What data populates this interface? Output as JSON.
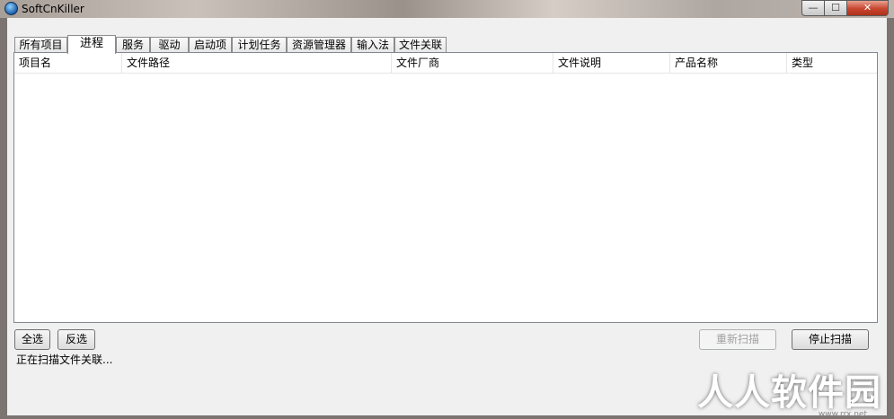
{
  "window": {
    "title": "SoftCnKiller",
    "min_glyph": "—",
    "max_glyph": "☐",
    "close_glyph": "✕"
  },
  "tabs": [
    {
      "label": "所有项目",
      "active": false
    },
    {
      "label": "进程",
      "active": true
    },
    {
      "label": "服务",
      "active": false
    },
    {
      "label": "驱动",
      "active": false
    },
    {
      "label": "启动项",
      "active": false
    },
    {
      "label": "计划任务",
      "active": false
    },
    {
      "label": "资源管理器",
      "active": false
    },
    {
      "label": "输入法",
      "active": false
    },
    {
      "label": "文件关联",
      "active": false
    }
  ],
  "list": {
    "columns": [
      "项目名",
      "文件路径",
      "文件厂商",
      "文件说明",
      "产品名称",
      "类型"
    ],
    "rows": []
  },
  "buttons": {
    "select_all": "全选",
    "invert_select": "反选",
    "rescan": "重新扫描",
    "stop_scan": "停止扫描"
  },
  "status": "正在扫描文件关联...",
  "watermark": {
    "text": "人人软件园",
    "url": "www.rrx.net"
  }
}
